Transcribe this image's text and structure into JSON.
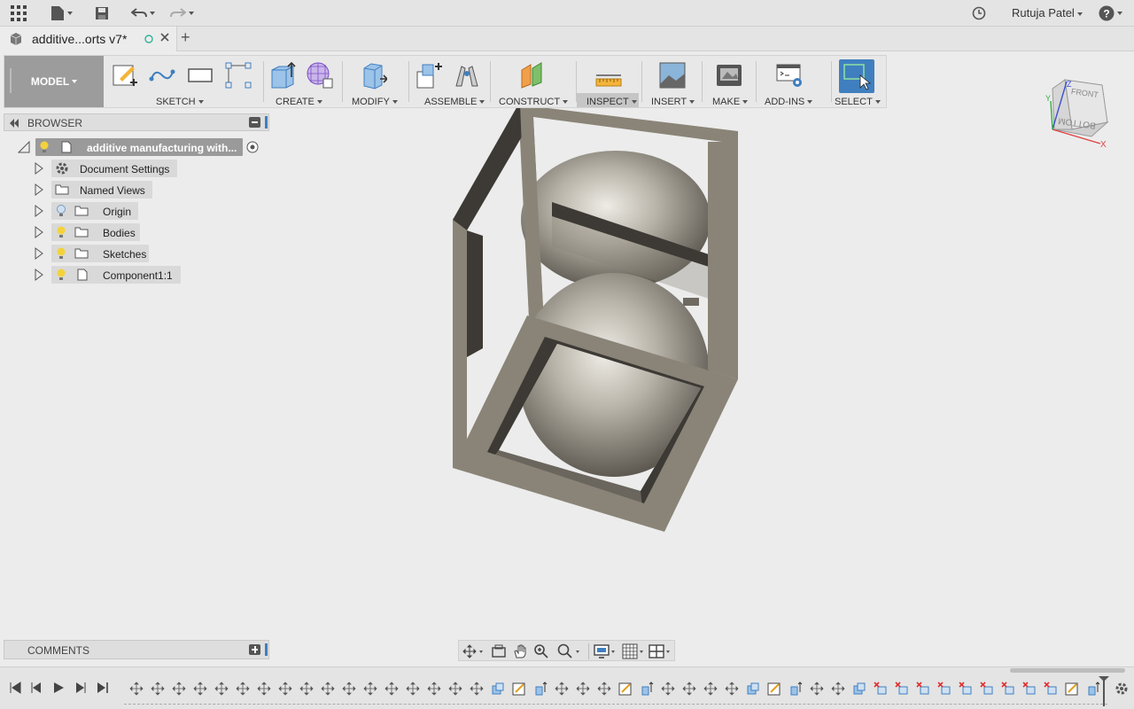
{
  "appbar": {
    "user_name": "Rutuja Patel",
    "icons": [
      "grid-menu-icon",
      "file-icon",
      "save-icon",
      "undo-icon",
      "redo-icon",
      "clock-icon",
      "help-icon"
    ]
  },
  "tab": {
    "title": "additive...orts v7*",
    "new_tab_label": "+"
  },
  "toolbar": {
    "mode_label": "MODEL",
    "groups": {
      "sketch": "SKETCH",
      "create": "CREATE",
      "modify": "MODIFY",
      "assemble": "ASSEMBLE",
      "construct": "CONSTRUCT",
      "inspect": "INSPECT",
      "insert": "INSERT",
      "make": "MAKE",
      "addins": "ADD-INS",
      "select": "SELECT"
    }
  },
  "browser": {
    "title": "BROWSER",
    "root_label": "additive manufacturing with...",
    "items": [
      {
        "label": "Document Settings",
        "icon": "gear-icon"
      },
      {
        "label": "Named Views",
        "icon": "folder-icon"
      },
      {
        "label": "Origin",
        "icon": "folder-icon"
      },
      {
        "label": "Bodies",
        "icon": "folder-icon"
      },
      {
        "label": "Sketches",
        "icon": "folder-icon"
      },
      {
        "label": "Component1:1",
        "icon": "component-icon"
      }
    ]
  },
  "comments": {
    "title": "COMMENTS"
  },
  "viewcube": {
    "face_front": "FRONT",
    "face_bottom": "BOTTOM",
    "axis_x": "X",
    "axis_y": "Y",
    "axis_z": "Z"
  },
  "colors": {
    "accent": "#3f7fbf",
    "model_button": "#9c9c9c",
    "frame": "#8a8478",
    "frame_dark": "#3d3a35"
  }
}
